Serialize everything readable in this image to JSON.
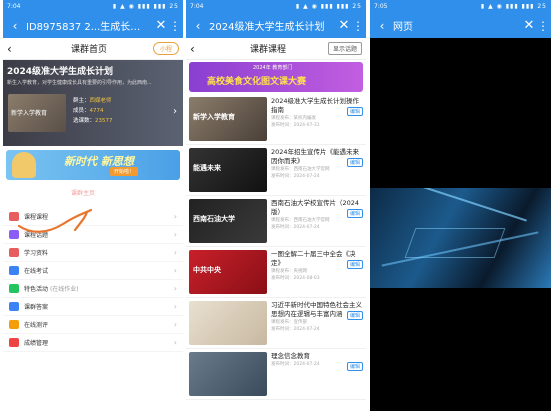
{
  "panel1": {
    "status": {
      "time": "7:04",
      "icons": "▮ ▲ ◉ ▮▮▮ ▮▮▮ 25"
    },
    "title": "ID8975837 2...生成长计划",
    "subtitle": "课群首页",
    "pill": "小程",
    "hero": {
      "title": "2024级准大学生成长计划",
      "desc": "新生入学教育，对学生健康成长具有重要的引导作用，为此西南...",
      "thumb_text": "新学入学教育",
      "stats": [
        {
          "label": "群主：",
          "value": "西媒老师"
        },
        {
          "label": "成员：",
          "value": "4774"
        },
        {
          "label": "选课数：",
          "value": "23577"
        }
      ]
    },
    "banner": {
      "text": "新时代 新思想",
      "button": "开始啦！"
    },
    "tab_faint": "课群主页",
    "menu": [
      {
        "label": "课程课程",
        "icon": "course-icon",
        "color": "#e85d5d"
      },
      {
        "label": "课程话题",
        "icon": "topic-icon",
        "color": "#8b5cf6"
      },
      {
        "label": "学习资料",
        "icon": "material-icon",
        "color": "#e85d5d"
      },
      {
        "label": "在线考试",
        "icon": "exam-icon",
        "color": "#3b82f6"
      },
      {
        "label": "特色活动",
        "extra": "(在线作业)",
        "icon": "activity-icon",
        "color": "#22c55e"
      },
      {
        "label": "课群答案",
        "icon": "answer-icon",
        "color": "#3b82f6"
      },
      {
        "label": "在线测评",
        "icon": "assess-icon",
        "color": "#f59e0b"
      },
      {
        "label": "成绩管理",
        "icon": "grade-icon",
        "color": "#ef4444"
      }
    ]
  },
  "panel2": {
    "status": {
      "time": "7:04",
      "icons": "▮ ▲ ◉ ▮▮▮ ▮▮▮ 25"
    },
    "title": "2024级准大学生成长计划",
    "subtitle": "课群课程",
    "pill": "显示话题",
    "banner": {
      "line1": "2024年 教育部门",
      "line2": "高校美食文化图文课大赛"
    },
    "courses": [
      {
        "title": "2024级准大学生成长计划操作指南",
        "meta1": "课程发布：某校内编发",
        "meta2": "发布时间：2024-07-31",
        "edit": "编辑",
        "thumb_text": "新学入学教育",
        "bg": "linear-gradient(135deg,#8b7d6b,#4a4038)"
      },
      {
        "title": "2024年招生宣传片《能遇未来 因你而来》",
        "meta1": "课程发布：西南石油大学官网",
        "meta2": "发布时间：2024-07-24",
        "edit": "编辑",
        "thumb_text": "能遇未来",
        "bg": "linear-gradient(135deg,#333,#111)"
      },
      {
        "title": "西南石油大学校宣传片（2024版）",
        "meta1": "课程发布：西南石油大学官网",
        "meta2": "发布时间：2024-07-24",
        "edit": "编辑",
        "thumb_text": "西南石油大学",
        "bg": "linear-gradient(135deg,#222,#3a3a3a)"
      },
      {
        "title": "一图全解二十届三中全会《决定》",
        "meta1": "课程发布：央视网",
        "meta2": "发布时间：2024-08-03",
        "edit": "编辑",
        "thumb_text": "中共中央",
        "bg": "linear-gradient(135deg,#c8202a,#8a0f16)"
      },
      {
        "title": "习近平新时代中国特色社会主义思想内在逻辑与丰富内涵",
        "meta1": "课程发布：宣传部",
        "meta2": "发布时间：2024-07-24",
        "edit": "编辑",
        "thumb_text": "",
        "bg": "linear-gradient(135deg,#e8e0d0,#c8b8a0)"
      },
      {
        "title": "理念信念教育",
        "meta1": "",
        "meta2": "发布时间：2024-07-24",
        "edit": "编辑",
        "thumb_text": "",
        "bg": "linear-gradient(135deg,#6a7b8c,#3a4b5c)"
      }
    ]
  },
  "panel3": {
    "status": {
      "time": "7:05",
      "icons": "▮ ▲ ◉ ▮▮▮ ▮▮▮ 25"
    },
    "title": "网页"
  }
}
